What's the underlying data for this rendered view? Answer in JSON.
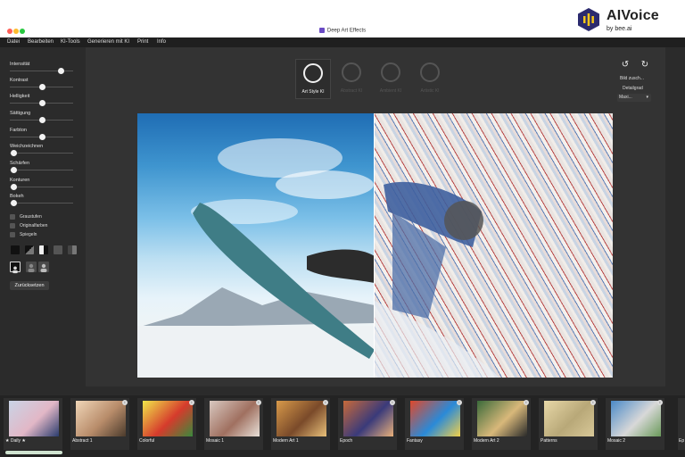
{
  "window": {
    "title": "Deep Art Effects"
  },
  "brand": {
    "name": "AIVoice",
    "by": "by",
    "sub": "bee.ai",
    "hex_color": "#2b2a6e",
    "bar_color": "#f5c518"
  },
  "menu": [
    "Datei",
    "Bearbeiten",
    "KI-Tools",
    "Generieren mit KI",
    "Print",
    "Info"
  ],
  "sliders": [
    {
      "label": "Intensität",
      "value": 0.8
    },
    {
      "label": "Kontrast",
      "value": 0.5
    },
    {
      "label": "Helligkeit",
      "value": 0.5
    },
    {
      "label": "Sättigung",
      "value": 0.5
    },
    {
      "label": "Farbton",
      "value": 0.5
    },
    {
      "label": "Weichzeichnen",
      "value": 0.05
    },
    {
      "label": "Schärfen",
      "value": 0.05
    },
    {
      "label": "Konturen",
      "value": 0.05
    },
    {
      "label": "Bokeh",
      "value": 0.05
    }
  ],
  "checkboxes": [
    "Graustufen",
    "Originalfarben",
    "Spiegeln"
  ],
  "reset_label": "Zurücksetzen",
  "style_buttons": [
    {
      "label": "Art Style KI",
      "active": true
    },
    {
      "label": "Abstract KI",
      "active": false
    },
    {
      "label": "Ambient KI",
      "active": false
    },
    {
      "label": "Artistic KI",
      "active": false
    }
  ],
  "right_panel": {
    "undo_icon": "rotate-left-icon",
    "redo_icon": "rotate-right-icon",
    "crop_label": "Bild zusch...",
    "detail_label": "Detailgrad",
    "detail_value": "Maxi...",
    "detail_arrow": "▾"
  },
  "thumbnails": [
    {
      "label": "★ Daily ★",
      "colors": [
        "#c9d4e6",
        "#e2b7c6",
        "#2a3c6e"
      ]
    },
    {
      "label": "Abstract 1",
      "colors": [
        "#f0d6b8",
        "#b88c6a",
        "#4b3b2c"
      ]
    },
    {
      "label": "Colorful",
      "colors": [
        "#f0e64a",
        "#d63b2c",
        "#3a8a3c"
      ]
    },
    {
      "label": "Mosaic 1",
      "colors": [
        "#d8c8c0",
        "#a07060",
        "#e8e0d8"
      ]
    },
    {
      "label": "Modern Art 1",
      "colors": [
        "#d89a4a",
        "#7a4a2a",
        "#e8c07a"
      ]
    },
    {
      "label": "Epoch",
      "colors": [
        "#c86a3a",
        "#3a3a7a",
        "#e8b07a"
      ]
    },
    {
      "label": "Fantasy",
      "colors": [
        "#e0482a",
        "#2a8ad8",
        "#f0d04a"
      ]
    },
    {
      "label": "Modern Art 2",
      "colors": [
        "#3a6a3a",
        "#d8b87a",
        "#2a2a2a"
      ]
    },
    {
      "label": "Patterns",
      "colors": [
        "#e8d8a8",
        "#b8a878",
        "#d8c898"
      ]
    },
    {
      "label": "Mosaic 2",
      "colors": [
        "#4a8ac8",
        "#d8d8d8",
        "#6a9a5a"
      ]
    }
  ],
  "thumb_partial_label": "Ep",
  "info_glyph": "i"
}
